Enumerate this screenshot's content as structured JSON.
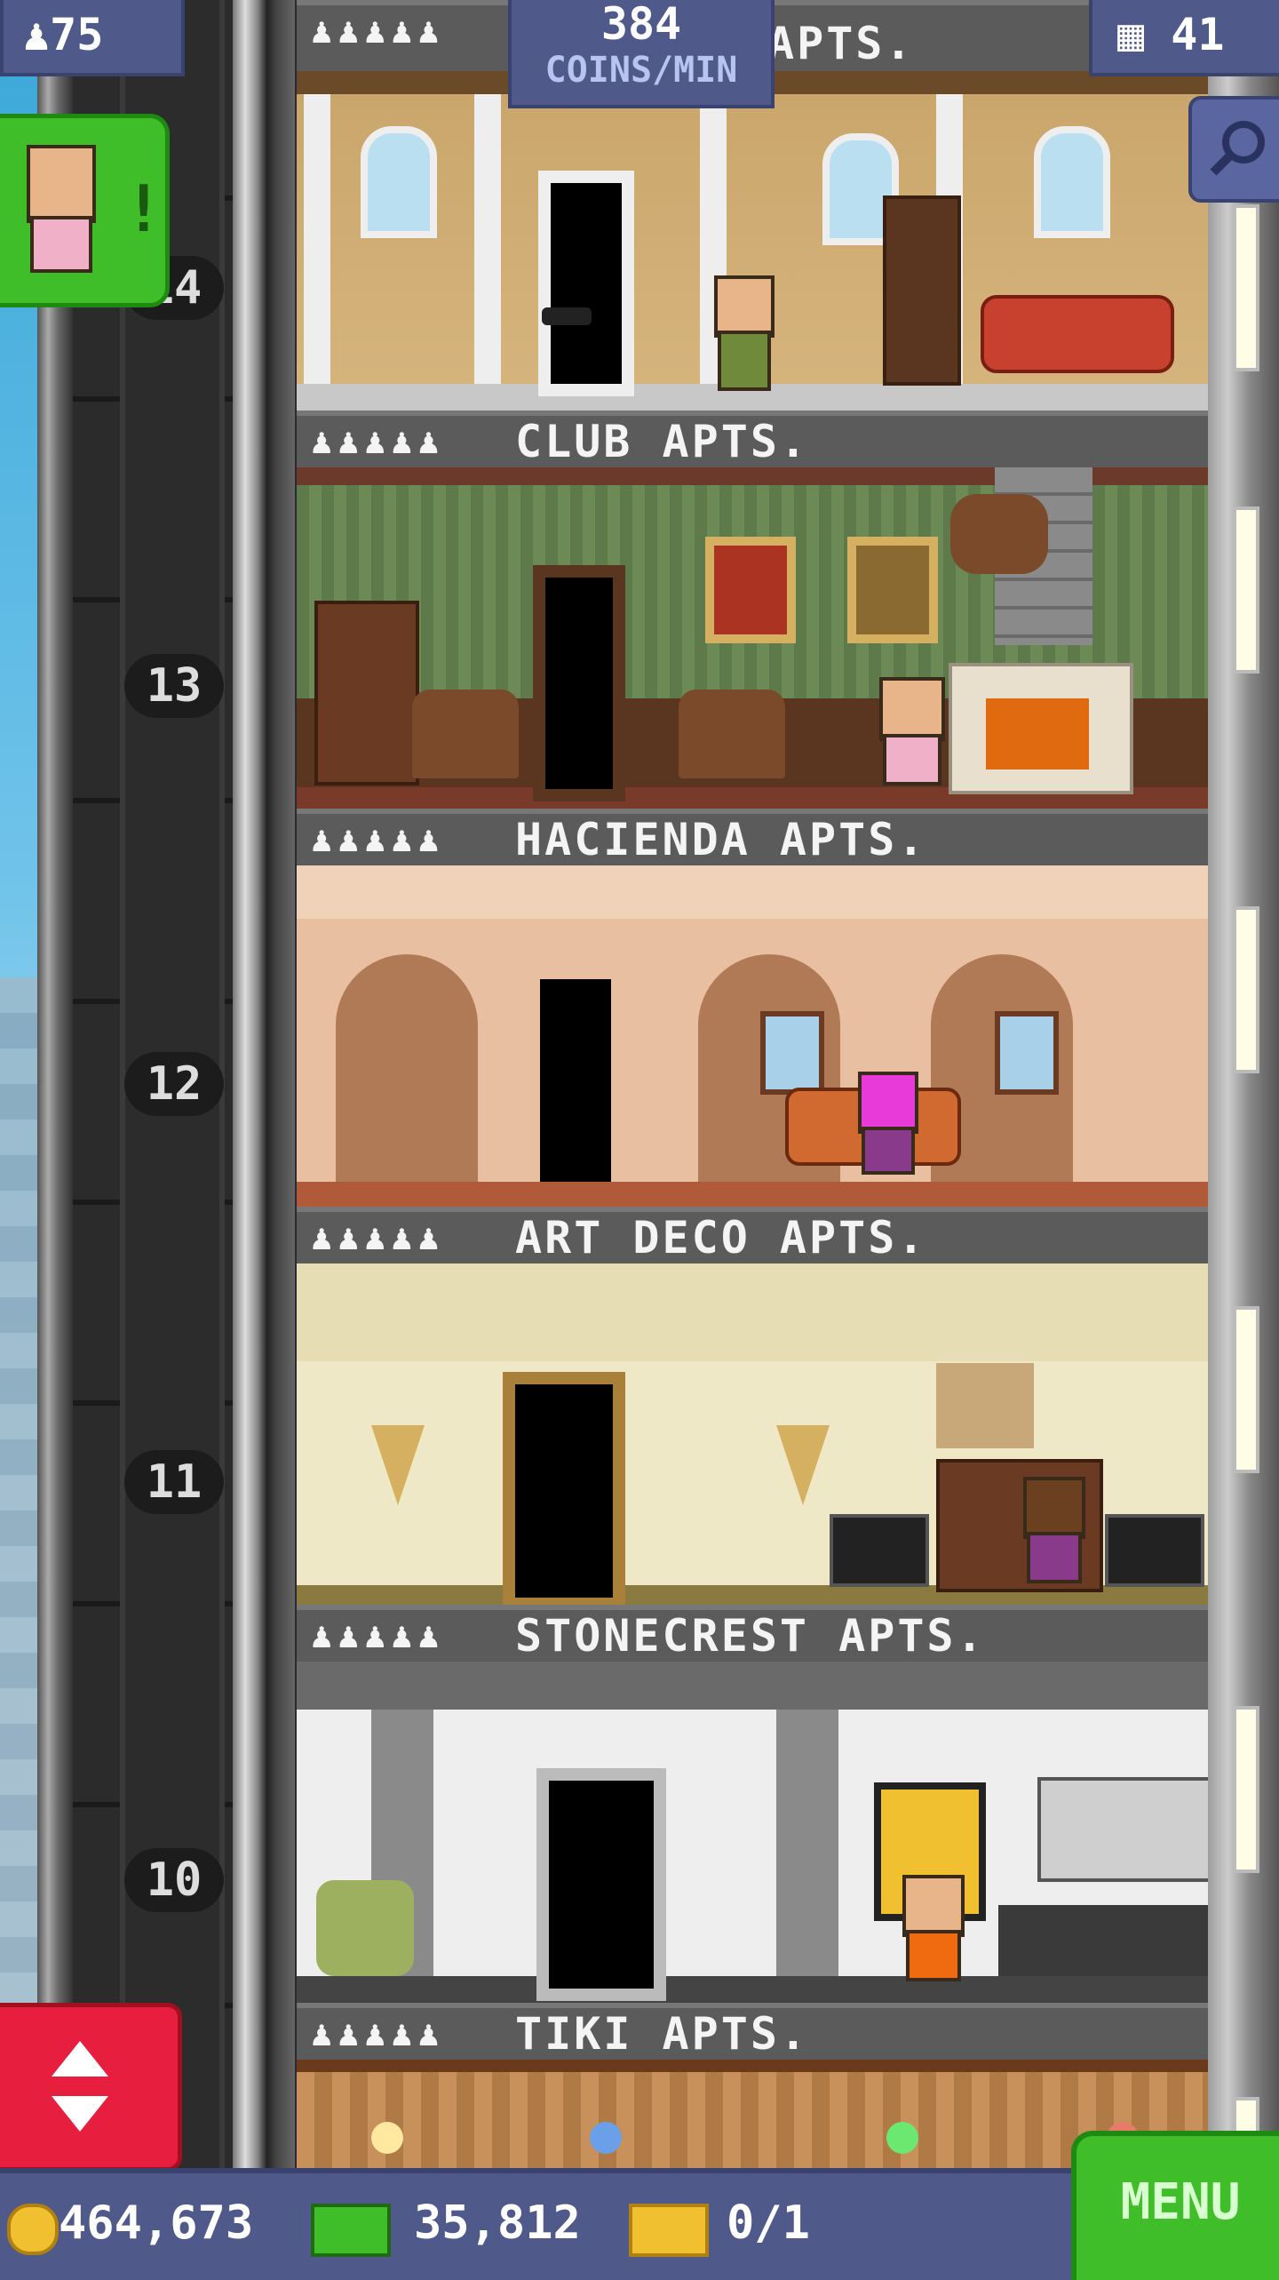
{
  "hud": {
    "population": "75",
    "rate_value": "384",
    "rate_unit": "COINS/MIN",
    "floors_count": "41"
  },
  "top_partial_label": "APTS.",
  "floors": [
    {
      "name": "CLUB APTS.",
      "people": "♟♟♟♟♟"
    },
    {
      "name": "HACIENDA APTS.",
      "people": "♟♟♟♟♟"
    },
    {
      "name": "ART DECO APTS.",
      "people": "♟♟♟♟♟"
    },
    {
      "name": "STONECREST APTS.",
      "people": "♟♟♟♟♟"
    },
    {
      "name": "TIKI APTS.",
      "people": "♟♟♟♟♟"
    }
  ],
  "top_people": "♟♟♟♟♟",
  "floor_numbers": [
    "14",
    "13",
    "12",
    "11",
    "10"
  ],
  "visitor_alert": "!",
  "currency": {
    "coins": "464,673",
    "bux": "35,812",
    "tickets": "0/1"
  },
  "menu_label": "MENU",
  "colors": {
    "hud_bg": "#4f5a8a",
    "green_button": "#3fbe2a",
    "red_button": "#e81e3e"
  },
  "icons": [
    "person-icon",
    "building-icon",
    "magnifier-icon",
    "coin-icon",
    "bux-icon",
    "ticket-icon",
    "elevator-arrows-icon"
  ]
}
